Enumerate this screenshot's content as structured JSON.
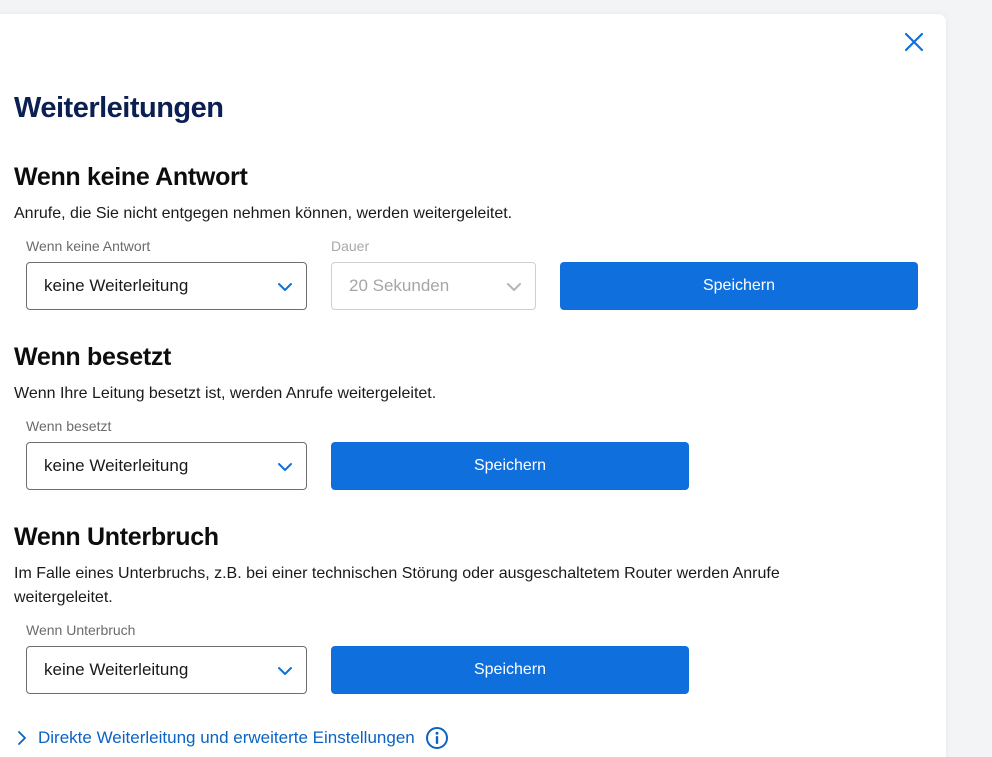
{
  "dialog": {
    "title": "Weiterleitungen",
    "close_label": "close"
  },
  "no_answer": {
    "heading": "Wenn keine Antwort",
    "description": "Anrufe, die Sie nicht entgegen nehmen können, werden weitergeleitet.",
    "select_label": "Wenn keine Antwort",
    "select_value": "keine Weiterleitung",
    "duration_label": "Dauer",
    "duration_value": "20 Sekunden",
    "save_label": "Speichern"
  },
  "busy": {
    "heading": "Wenn besetzt",
    "description": "Wenn Ihre Leitung besetzt ist, werden Anrufe weitergeleitet.",
    "select_label": "Wenn besetzt",
    "select_value": "keine Weiterleitung",
    "save_label": "Speichern"
  },
  "interruption": {
    "heading": "Wenn Unterbruch",
    "description_line1": "Im Falle eines Unterbruchs, z.B. bei einer technischen Störung oder ausgeschaltetem Router werden Anrufe",
    "description_line2": "weitergeleitet.",
    "select_label": "Wenn Unterbruch",
    "select_value": "keine Weiterleitung",
    "save_label": "Speichern"
  },
  "advanced_link": {
    "label": "Direkte Weiterleitung und erweiterte Einstellungen"
  },
  "colors": {
    "primary_button": "#0f6fdc",
    "link": "#0b63c4",
    "title": "#0b1f52"
  },
  "icons": [
    "close-icon",
    "chevron-down-icon",
    "chevron-right-icon",
    "info-icon"
  ]
}
